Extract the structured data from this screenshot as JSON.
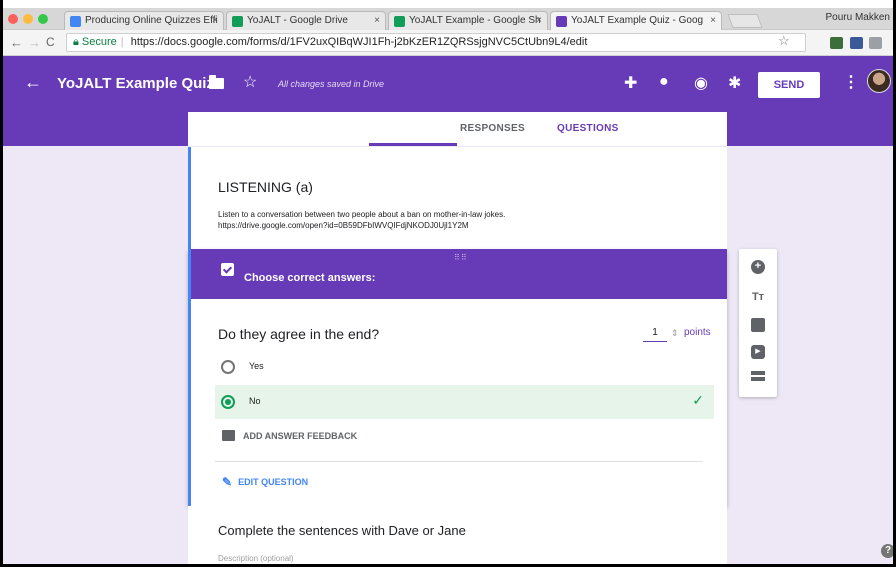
{
  "browser": {
    "tabs": [
      {
        "label": "Producing Online Quizzes Effi",
        "favicon_color": "#4285f4"
      },
      {
        "label": "YoJALT - Google Drive",
        "favicon_color": "#0f9d58"
      },
      {
        "label": "YoJALT Example - Google Sh",
        "favicon_color": "#0f9d58"
      },
      {
        "label": "YoJALT Example Quiz - Goog",
        "favicon_color": "#673ab7"
      }
    ],
    "close_glyph": "×",
    "user_name": "Pouru Makken",
    "secure_label": "Secure",
    "url": "https://docs.google.com/forms/d/1FV2uxQIBqWJI1Fh-j2bKzER1ZQRSsjgNVC5CtUbn9L4/edit"
  },
  "header": {
    "back_glyph": "←",
    "title": "YoJALT Example Quiz",
    "saved_status": "All changes saved in Drive",
    "send_label": "SEND",
    "more_glyph": "⋮"
  },
  "tabs": {
    "questions": "QUESTIONS",
    "responses": "RESPONSES"
  },
  "section": {
    "title": "LISTENING (a)",
    "description_line1": "Listen to a conversation between two people about a ban on mother-in-law jokes.",
    "description_line2": "https://drive.google.com/open?id=0B59DFbIWVQIFdjNKODJ0Ujl1Y2M"
  },
  "question": {
    "answer_key_label": "Choose correct answers:",
    "text": "Do they agree in the end?",
    "points_value": "1",
    "points_label": "points",
    "options": [
      {
        "label": "Yes",
        "correct": false
      },
      {
        "label": "No",
        "correct": true
      }
    ],
    "feedback_label": "ADD ANSWER FEEDBACK",
    "edit_label": "EDIT QUESTION"
  },
  "next_question": {
    "title": "Complete the sentences with Dave or Jane",
    "description_placeholder": "Description (optional)"
  },
  "colors": {
    "accent": "#673ab7",
    "page_bg": "#ede7f6",
    "correct_green": "#0f9d58",
    "blue": "#4285f4"
  },
  "icons": [
    "back-arrow-icon",
    "folder-icon",
    "star-icon",
    "addons-icon",
    "palette-icon",
    "preview-eye-icon",
    "settings-gear-icon",
    "more-vert-icon",
    "add-question-icon",
    "add-title-icon",
    "add-image-icon",
    "add-video-icon",
    "add-section-icon",
    "help-icon"
  ]
}
